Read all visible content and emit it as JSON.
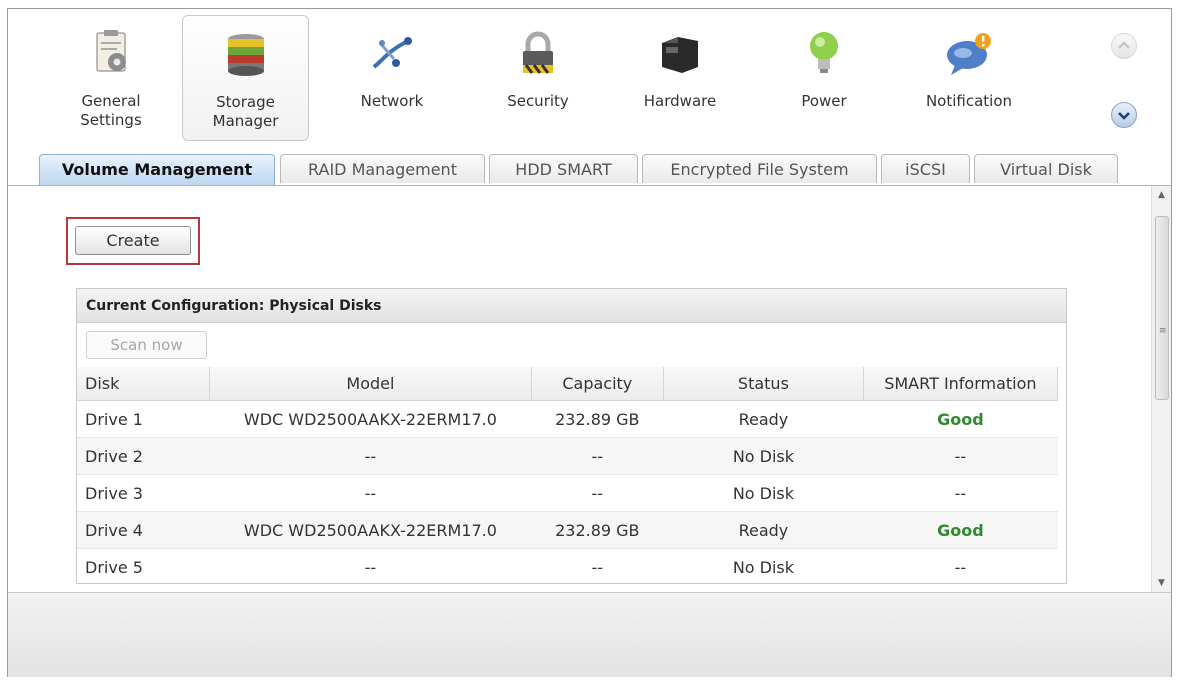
{
  "apps": [
    {
      "label": "General\nSettings",
      "icon": "general-settings-icon"
    },
    {
      "label": "Storage\nManager",
      "icon": "storage-manager-icon",
      "active": true
    },
    {
      "label": "Network",
      "icon": "network-icon"
    },
    {
      "label": "Security",
      "icon": "security-lock-icon"
    },
    {
      "label": "Hardware",
      "icon": "hardware-icon"
    },
    {
      "label": "Power",
      "icon": "power-bulb-icon"
    },
    {
      "label": "Notification",
      "icon": "notification-icon"
    }
  ],
  "tabs": [
    {
      "label": "Volume Management",
      "active": true
    },
    {
      "label": "RAID Management"
    },
    {
      "label": "HDD SMART"
    },
    {
      "label": "Encrypted File System"
    },
    {
      "label": "iSCSI"
    },
    {
      "label": "Virtual Disk"
    }
  ],
  "create_label": "Create",
  "panel": {
    "title": "Current Configuration: Physical Disks",
    "scan_label": "Scan now",
    "columns": [
      "Disk",
      "Model",
      "Capacity",
      "Status",
      "SMART Information"
    ],
    "rows": [
      {
        "disk": "Drive 1",
        "model": "WDC WD2500AAKX-22ERM17.0",
        "capacity": "232.89 GB",
        "status": "Ready",
        "smart": "Good"
      },
      {
        "disk": "Drive 2",
        "model": "--",
        "capacity": "--",
        "status": "No Disk",
        "smart": "--"
      },
      {
        "disk": "Drive 3",
        "model": "--",
        "capacity": "--",
        "status": "No Disk",
        "smart": "--"
      },
      {
        "disk": "Drive 4",
        "model": "WDC WD2500AAKX-22ERM17.0",
        "capacity": "232.89 GB",
        "status": "Ready",
        "smart": "Good"
      },
      {
        "disk": "Drive 5",
        "model": "--",
        "capacity": "--",
        "status": "No Disk",
        "smart": "--"
      }
    ]
  },
  "colors": {
    "accent_tab": "#bcd6f1",
    "good": "#2e8b2e",
    "highlight_box": "#b8383a"
  }
}
